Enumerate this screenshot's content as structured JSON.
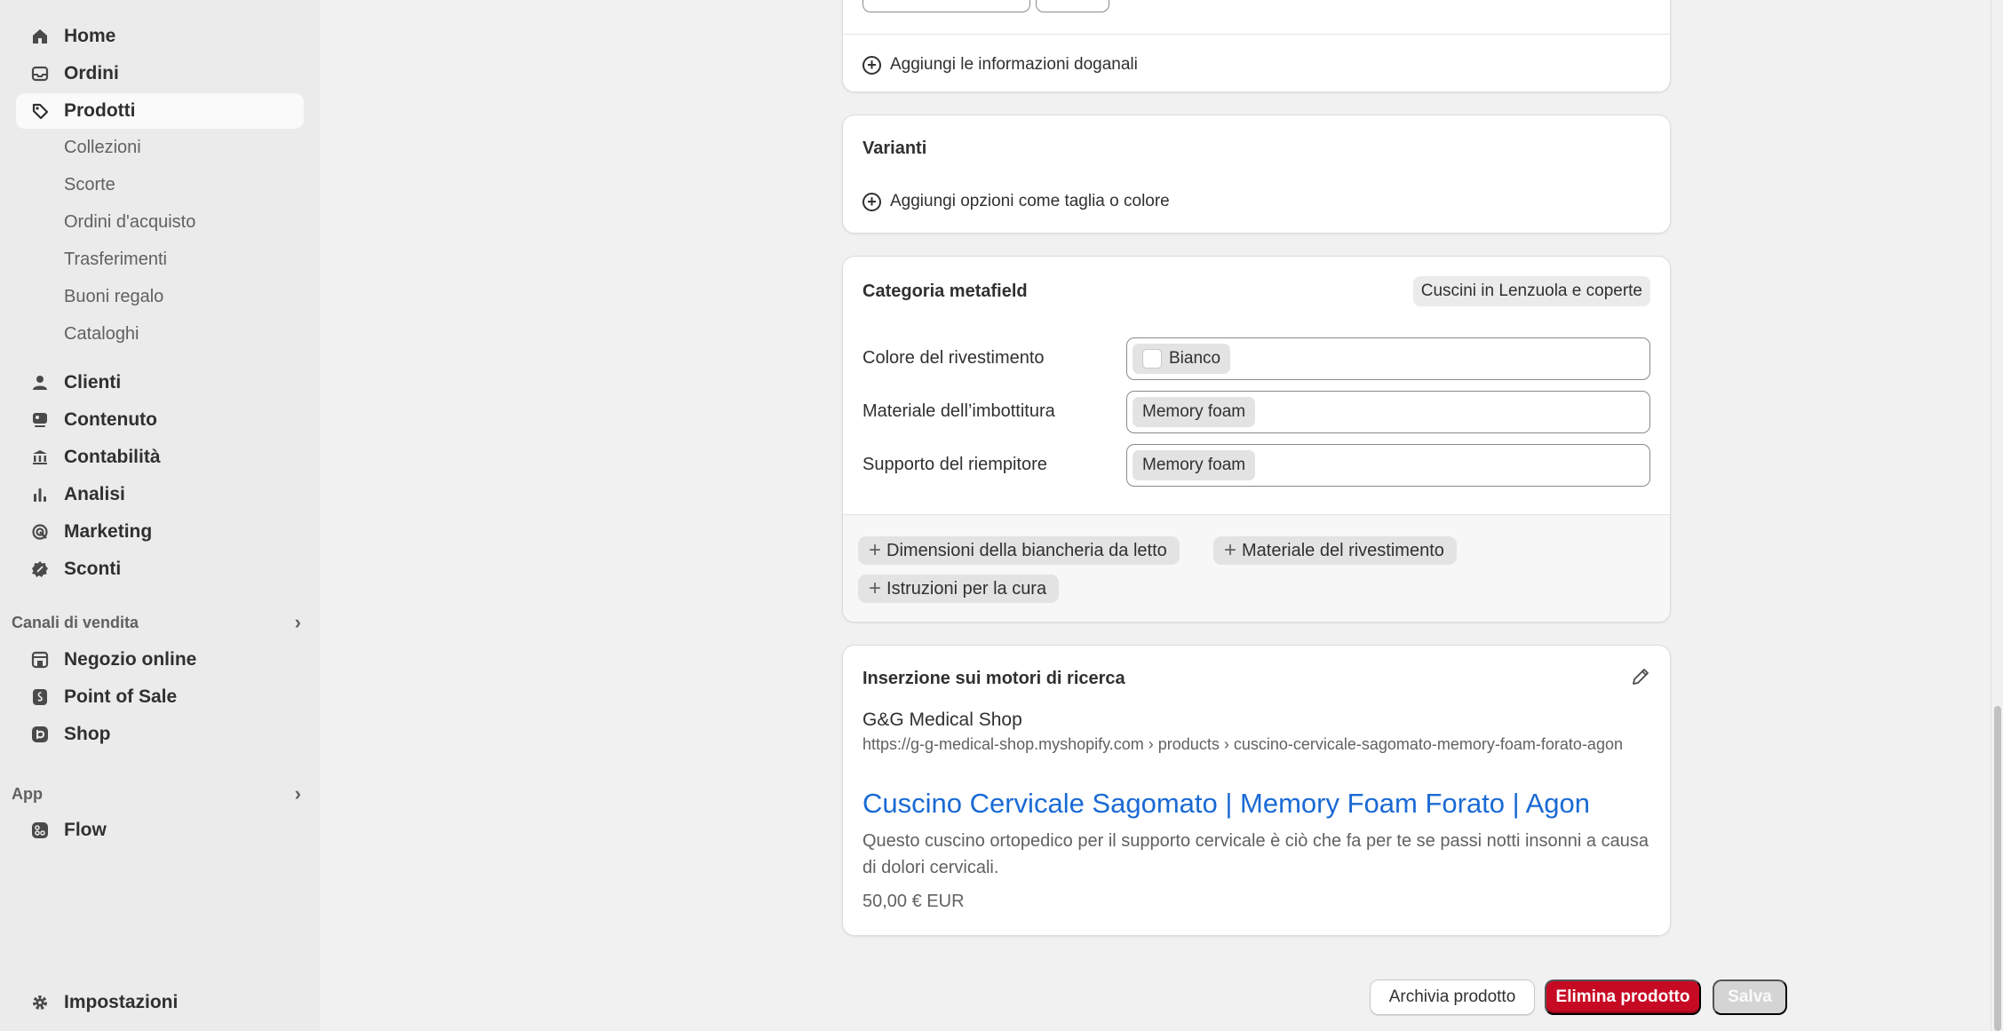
{
  "sidebar": {
    "items": [
      {
        "label": "Home",
        "icon": "home-icon"
      },
      {
        "label": "Ordini",
        "icon": "inbox-icon"
      },
      {
        "label": "Prodotti",
        "icon": "tag-icon",
        "active": true
      }
    ],
    "product_subitems": [
      "Collezioni",
      "Scorte",
      "Ordini d'acquisto",
      "Trasferimenti",
      "Buoni regalo",
      "Cataloghi"
    ],
    "items2": [
      {
        "label": "Clienti",
        "icon": "person-icon"
      },
      {
        "label": "Contenuto",
        "icon": "content-icon"
      },
      {
        "label": "Contabilità",
        "icon": "bank-icon"
      },
      {
        "label": "Analisi",
        "icon": "chart-icon"
      },
      {
        "label": "Marketing",
        "icon": "target-icon"
      },
      {
        "label": "Sconti",
        "icon": "discount-icon"
      }
    ],
    "sales_channels_heading": "Canali di vendita",
    "sales_channels": [
      {
        "label": "Negozio online",
        "icon": "store-icon"
      },
      {
        "label": "Point of Sale",
        "icon": "pos-icon"
      },
      {
        "label": "Shop",
        "icon": "shop-icon"
      }
    ],
    "apps_heading": "App",
    "apps": [
      {
        "label": "Flow",
        "icon": "flow-icon"
      }
    ],
    "settings": "Impostazioni"
  },
  "customs": {
    "add_label": "Aggiungi le informazioni doganali"
  },
  "variants": {
    "title": "Varianti",
    "add_label": "Aggiungi opzioni come taglia o colore"
  },
  "metafields": {
    "title": "Categoria metafield",
    "category": "Cuscini in Lenzuola e coperte",
    "rows": [
      {
        "label": "Colore del rivestimento",
        "value": "Bianco",
        "swatch": "#ffffff"
      },
      {
        "label": "Materiale dell’imbottitura",
        "value": "Memory foam"
      },
      {
        "label": "Supporto del riempitore",
        "value": "Memory foam"
      }
    ],
    "add_chips": [
      "Dimensioni della biancheria da letto",
      "Materiale del rivestimento",
      "Istruzioni per la cura"
    ]
  },
  "seo": {
    "title": "Inserzione sui motori di ricerca",
    "store": "G&G Medical Shop",
    "url": "https://g-g-medical-shop.myshopify.com › products › cuscino-cervicale-sagomato-memory-foam-forato-agon",
    "page_title": "Cuscino Cervicale Sagomato | Memory Foam Forato | Agon",
    "description": "Questo cuscino ortopedico per il supporto cervicale è ciò che fa per te se passi notti insonni a causa di dolori cervicali.",
    "price": "50,00 € EUR"
  },
  "actions": {
    "archive": "Archivia prodotto",
    "delete": "Elimina prodotto",
    "save": "Salva"
  },
  "colors": {
    "accent_danger": "#c70a24",
    "link": "#1a6ad4"
  }
}
